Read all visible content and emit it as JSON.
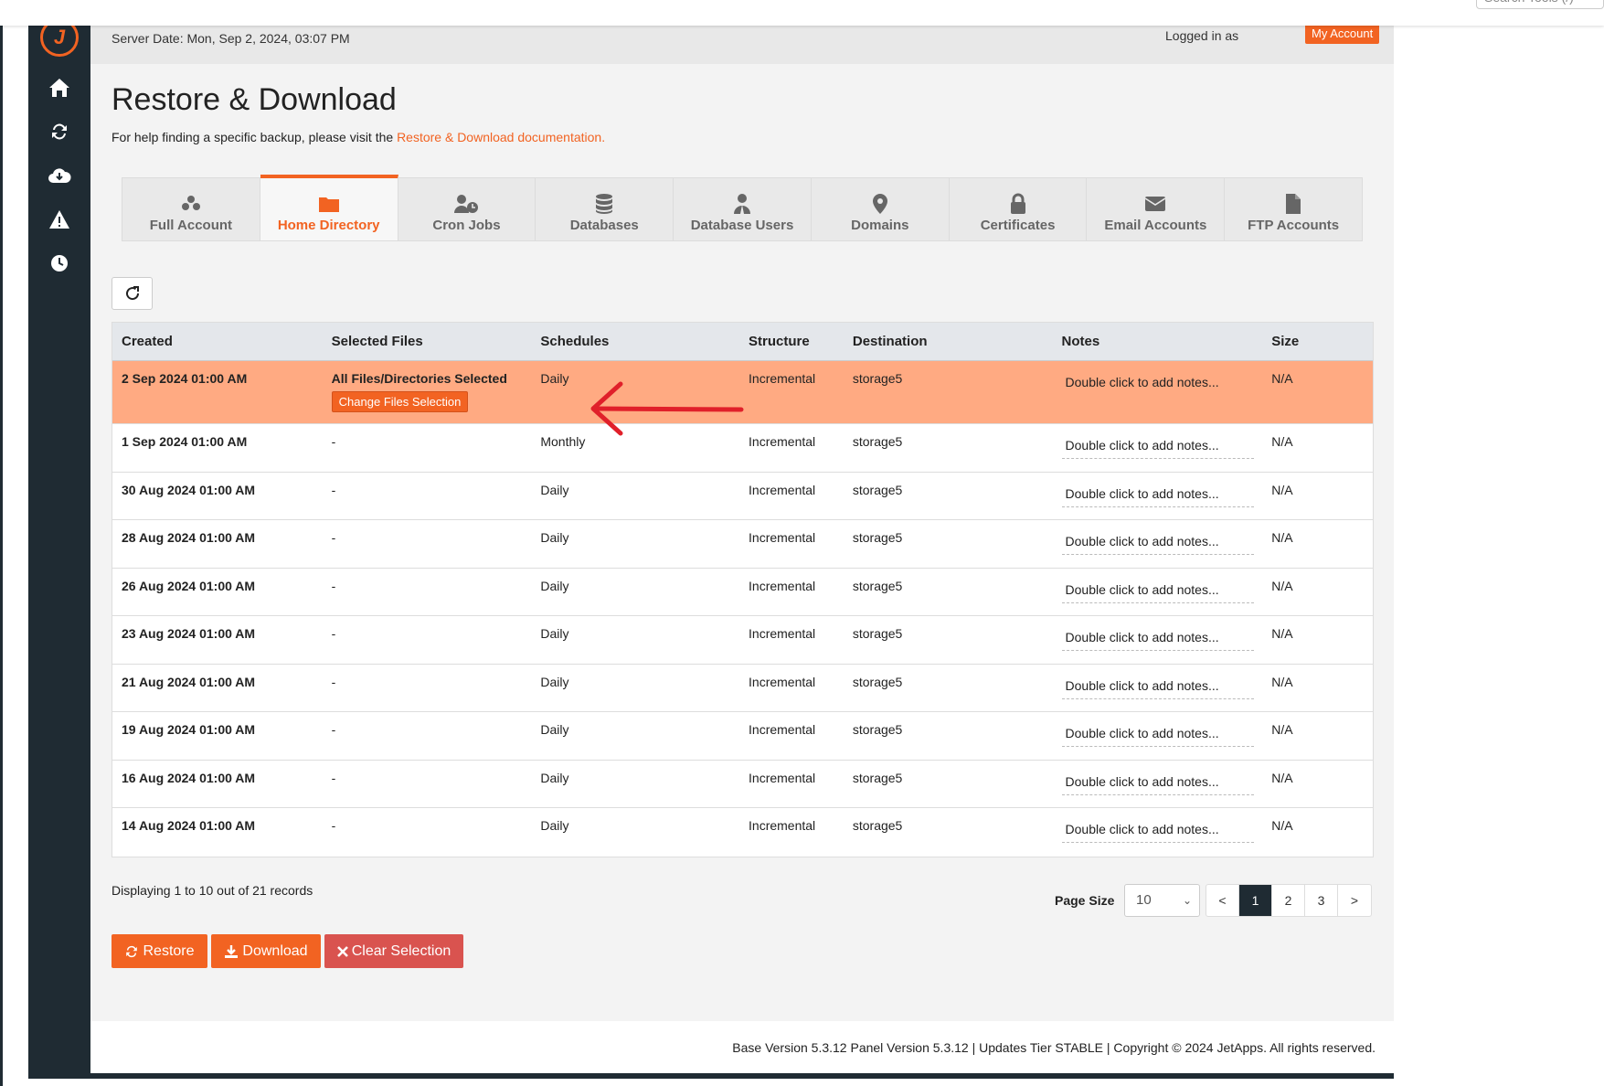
{
  "search": {
    "placeholder": "Search Tools (/)"
  },
  "header": {
    "server_date": "Server Date: Mon, Sep 2, 2024, 03:07 PM",
    "logged_in": "Logged in as",
    "my_account": "My Account"
  },
  "sidebar": {
    "items": [
      {
        "icon": "home-icon"
      },
      {
        "icon": "sync-icon"
      },
      {
        "icon": "cloud-download-icon"
      },
      {
        "icon": "warning-icon"
      },
      {
        "icon": "clock-icon"
      }
    ]
  },
  "page": {
    "title": "Restore & Download",
    "help_prefix": "For help finding a specific backup, please visit the ",
    "help_link": "Restore & Download documentation."
  },
  "tabs": [
    {
      "label": "Full Account",
      "icon": "users-icon",
      "active": false
    },
    {
      "label": "Home Directory",
      "icon": "folder-icon",
      "active": true
    },
    {
      "label": "Cron Jobs",
      "icon": "user-clock-icon",
      "active": false
    },
    {
      "label": "Databases",
      "icon": "database-icon",
      "active": false
    },
    {
      "label": "Database Users",
      "icon": "user-tie-icon",
      "active": false
    },
    {
      "label": "Domains",
      "icon": "map-marker-icon",
      "active": false
    },
    {
      "label": "Certificates",
      "icon": "lock-icon",
      "active": false
    },
    {
      "label": "Email Accounts",
      "icon": "envelope-icon",
      "active": false
    },
    {
      "label": "FTP Accounts",
      "icon": "file-icon",
      "active": false
    }
  ],
  "table": {
    "headers": [
      "Created",
      "Selected Files",
      "Schedules",
      "Structure",
      "Destination",
      "Notes",
      "Size"
    ],
    "rows": [
      {
        "created": "2 Sep 2024 01:00 AM",
        "selected": "All Files/Directories Selected",
        "change_label": "Change Files Selection",
        "schedule": "Daily",
        "structure": "Incremental",
        "destination": "storage5",
        "notes": "Double click to add notes...",
        "size": "N/A"
      },
      {
        "created": "1 Sep 2024 01:00 AM",
        "selected": "-",
        "schedule": "Monthly",
        "structure": "Incremental",
        "destination": "storage5",
        "notes": "Double click to add notes...",
        "size": "N/A"
      },
      {
        "created": "30 Aug 2024 01:00 AM",
        "selected": "-",
        "schedule": "Daily",
        "structure": "Incremental",
        "destination": "storage5",
        "notes": "Double click to add notes...",
        "size": "N/A"
      },
      {
        "created": "28 Aug 2024 01:00 AM",
        "selected": "-",
        "schedule": "Daily",
        "structure": "Incremental",
        "destination": "storage5",
        "notes": "Double click to add notes...",
        "size": "N/A"
      },
      {
        "created": "26 Aug 2024 01:00 AM",
        "selected": "-",
        "schedule": "Daily",
        "structure": "Incremental",
        "destination": "storage5",
        "notes": "Double click to add notes...",
        "size": "N/A"
      },
      {
        "created": "23 Aug 2024 01:00 AM",
        "selected": "-",
        "schedule": "Daily",
        "structure": "Incremental",
        "destination": "storage5",
        "notes": "Double click to add notes...",
        "size": "N/A"
      },
      {
        "created": "21 Aug 2024 01:00 AM",
        "selected": "-",
        "schedule": "Daily",
        "structure": "Incremental",
        "destination": "storage5",
        "notes": "Double click to add notes...",
        "size": "N/A"
      },
      {
        "created": "19 Aug 2024 01:00 AM",
        "selected": "-",
        "schedule": "Daily",
        "structure": "Incremental",
        "destination": "storage5",
        "notes": "Double click to add notes...",
        "size": "N/A"
      },
      {
        "created": "16 Aug 2024 01:00 AM",
        "selected": "-",
        "schedule": "Daily",
        "structure": "Incremental",
        "destination": "storage5",
        "notes": "Double click to add notes...",
        "size": "N/A"
      },
      {
        "created": "14 Aug 2024 01:00 AM",
        "selected": "-",
        "schedule": "Daily",
        "structure": "Incremental",
        "destination": "storage5",
        "notes": "Double click to add notes...",
        "size": "N/A"
      }
    ]
  },
  "pagination": {
    "displaying": "Displaying 1 to 10 out of 21 records",
    "page_size_label": "Page Size",
    "page_size_value": "10",
    "prev": "<",
    "pages": [
      "1",
      "2",
      "3"
    ],
    "current_page": "1",
    "next": ">"
  },
  "actions": {
    "restore": "Restore",
    "download": "Download",
    "clear": "Clear Selection"
  },
  "footer": {
    "text": "Base Version 5.3.12 Panel Version 5.3.12 | Updates Tier STABLE | Copyright © 2024 JetApps. All rights reserved."
  },
  "colors": {
    "accent": "#f26322",
    "sidebar": "#1f2b33",
    "selected_row": "#ffaa82",
    "danger": "#d9534f",
    "annotation_arrow": "#e0202a"
  }
}
